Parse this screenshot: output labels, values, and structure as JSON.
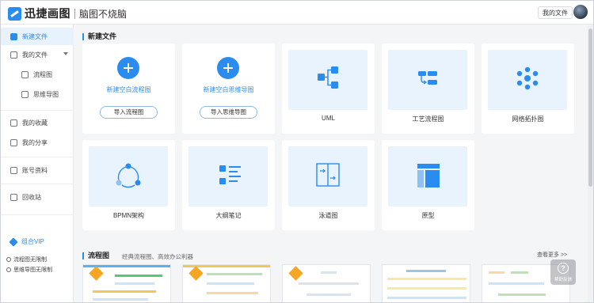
{
  "app": {
    "brand": "迅捷画图",
    "slogan": "脑图不烧脑"
  },
  "header": {
    "my_files_label": "我的文件"
  },
  "sidebar": {
    "items": [
      {
        "label": "新建文件",
        "icon": "plus-square-icon",
        "active": true
      },
      {
        "label": "我的文件",
        "icon": "file-icon"
      },
      {
        "label": "流程图",
        "icon": "flowchart-icon"
      },
      {
        "label": "思维导图",
        "icon": "mindmap-icon"
      },
      {
        "label": "我的收藏",
        "icon": "star-folder-icon"
      },
      {
        "label": "我的分享",
        "icon": "share-icon"
      },
      {
        "label": "账号资料",
        "icon": "user-icon"
      },
      {
        "label": "回收站",
        "icon": "trash-icon"
      }
    ],
    "vip_label": "组合VIP",
    "limits": [
      "流程图无限制",
      "思维导图无限制"
    ]
  },
  "new_file": {
    "section_title": "新建文件",
    "blank_flow": {
      "label": "新建空白流程图",
      "import_label": "导入流程图"
    },
    "blank_mind": {
      "label": "新建空白思维导图",
      "import_label": "导入思维导图"
    },
    "templates": [
      {
        "label": "UML",
        "icon": "uml-icon"
      },
      {
        "label": "工艺流程图",
        "icon": "process-flow-icon"
      },
      {
        "label": "网络拓扑图",
        "icon": "network-topology-icon"
      },
      {
        "label": "BPMN架构",
        "icon": "bpmn-icon"
      },
      {
        "label": "大纲笔记",
        "icon": "outline-notes-icon"
      },
      {
        "label": "泳道图",
        "icon": "swimlane-icon"
      },
      {
        "label": "原型",
        "icon": "prototype-icon"
      }
    ]
  },
  "flow_section": {
    "title": "流程图",
    "subtitle": "经典流程图、高效办公利器",
    "more_label": "查看更多 >>"
  },
  "help": {
    "label": "帮助反馈"
  },
  "colors": {
    "accent": "#2b8cf0",
    "card_bg": "#e8f3fd",
    "badge": "#f5a623"
  }
}
